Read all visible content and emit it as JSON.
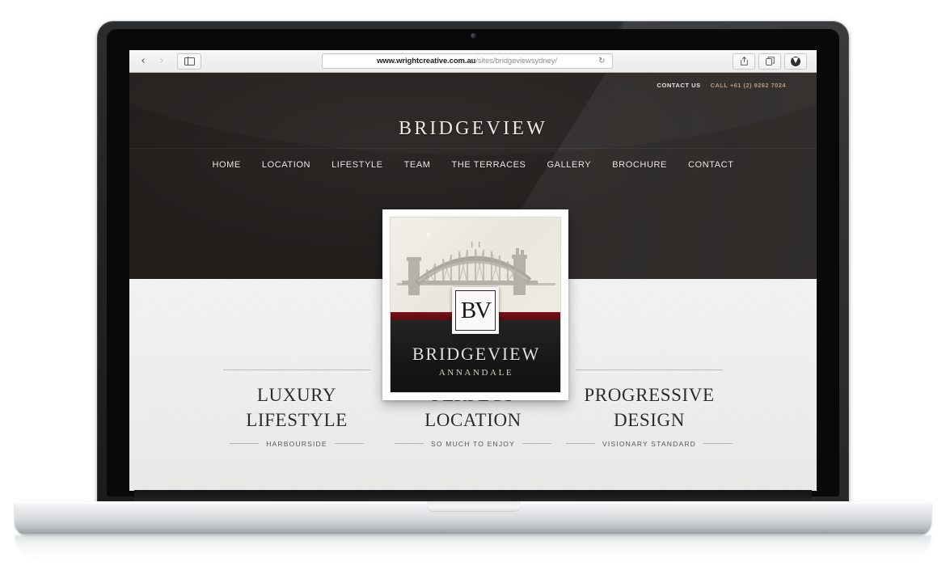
{
  "browser": {
    "back_icon": "chevron-left-icon",
    "forward_icon": "chevron-right-icon",
    "sidebar_icon": "sidebar-toggle-icon",
    "url_domain": "www.wrightcreative.com.au",
    "url_path": "/sites/bridgeviewsydney/",
    "reload_icon": "reload-icon",
    "share_icon": "share-icon",
    "tabs_icon": "tabs-icon",
    "download_icon": "download-icon"
  },
  "site": {
    "topbar": {
      "contact_label": "CONTACT US",
      "phone_label": "CALL +61 (2) 9262 7024",
      "phone_color": "#b99a72"
    },
    "brand": "BRIDGEVIEW",
    "nav": [
      {
        "label": "HOME"
      },
      {
        "label": "LOCATION"
      },
      {
        "label": "LIFESTYLE"
      },
      {
        "label": "TEAM"
      },
      {
        "label": "THE TERRACES"
      },
      {
        "label": "GALLERY"
      },
      {
        "label": "BROCHURE"
      },
      {
        "label": "CONTACT"
      }
    ],
    "logo_card": {
      "monogram": "BV",
      "name": "BRIDGEVIEW",
      "suburb": "ANNANDALE",
      "illustration": "sydney-harbour-bridge",
      "accent_color": "#6b0d14"
    },
    "features": [
      {
        "line1": "LUXURY",
        "line2": "LIFESTYLE",
        "subtitle": "HARBOURSIDE"
      },
      {
        "line1": "PERFECT",
        "line2": "LOCATION",
        "subtitle": "SO MUCH TO ENJOY"
      },
      {
        "line1": "PROGRESSIVE",
        "line2": "DESIGN",
        "subtitle": "VISIONARY STANDARD"
      }
    ],
    "hero_bg_color": "#211e1c"
  }
}
